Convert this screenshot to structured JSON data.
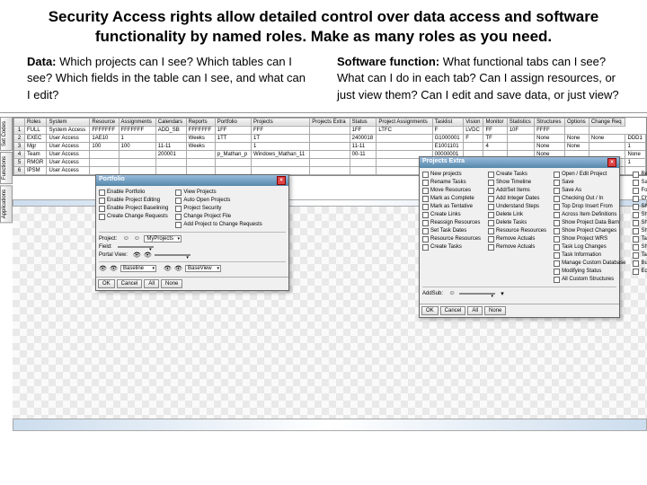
{
  "heading": "Security Access rights allow detailed control over data access and software functionality by named roles.  Make as many roles as you need.",
  "left_sub_label": "Data:",
  "left_sub_text": " Which projects can I see? Which tables can I see? Which fields in the table can I see, and what can I edit?",
  "right_sub_label": "Software function:",
  "right_sub_text": " What functional tabs can I see?  What can I do in each tab? Can I assign resources, or just view them? Can I edit and save data, or just view?",
  "vtabs": [
    "Set Codes",
    "Functions",
    "Applications"
  ],
  "columns": [
    "",
    "Roles",
    "System",
    "Resource",
    "Assignments",
    "Calendars",
    "Reports",
    "Portfolio",
    "Projects",
    "Projects Extra",
    "Status",
    "Project Assignments",
    "Tasklist",
    "Vision",
    "Monitor",
    "Statistics",
    "Structures",
    "Options",
    "Change Req"
  ],
  "rows": [
    [
      "1",
      "FULL",
      "System Access",
      "FFFFFFF",
      "FFFFFFF",
      "ADD_SB",
      "FFFFFFF",
      "1FF",
      "FFF",
      "",
      "1FF",
      "LTFC",
      "F",
      "LVDC",
      "FF",
      "10F",
      "FFFF",
      ""
    ],
    [
      "2",
      "EXEC",
      "User Access",
      "1AE10",
      "1",
      "",
      "Weeks",
      "1TT",
      "1T",
      "",
      "2400018",
      "",
      "G1000001",
      "F",
      "TF",
      "",
      "None",
      "None",
      "None",
      "DDD1"
    ],
    [
      "3",
      "Mgr",
      "User Access",
      "100",
      "100",
      "11-11",
      "Weeks",
      "",
      "1",
      "",
      "11-11",
      "",
      "E1001101",
      "",
      "4",
      "",
      "None",
      "None",
      "",
      "1"
    ],
    [
      "4",
      "Team",
      "User Access",
      "",
      "",
      "200001",
      "",
      "p_Mathan_p",
      "Windows_Mathan_11",
      "",
      "00-11",
      "",
      "00000001",
      "",
      "",
      "",
      "None",
      "",
      "",
      "None"
    ],
    [
      "5",
      "RMGR",
      "User Access",
      "",
      "",
      "",
      "",
      "",
      "",
      "",
      "",
      "",
      "",
      "",
      "",
      "",
      "",
      "",
      "",
      "1"
    ],
    [
      "6",
      "IPSM",
      "User Access",
      "",
      "",
      "",
      "",
      "",
      "",
      "",
      "",
      "",
      "",
      "",
      "",
      "",
      "",
      "",
      "",
      ""
    ]
  ],
  "popup1": {
    "title": "Portfolio",
    "colA": [
      "Enable Portfolio",
      "Enable Project Editing",
      "Enable Project Baselining",
      "Create Change Requests"
    ],
    "colB": [
      "View Projects",
      "Auto Open Projects",
      "Project Security",
      "Change Project File",
      "Add Project to Change Requests"
    ],
    "projectLabel": "Project:",
    "projectVal": "MyProjects",
    "fieldLabel": "Field:",
    "portalLabel": "Portal View:",
    "colC": [
      "",
      "",
      "",
      "Baseline",
      "BaseView"
    ]
  },
  "popup2": {
    "title": "Projects Extra",
    "colA": [
      "New projects",
      "Rename Tasks",
      "Move Resources",
      "Mark as Complete",
      "Mark as Tentative",
      "Create Links",
      "Reassign Resources",
      "Set Task Dates",
      "Resource Resources",
      "Create Tasks"
    ],
    "colB": [
      "Create Tasks",
      "Show Timeline",
      "Add/Set Items",
      "Add Integer Dates",
      "Understand Steps",
      "Delete Link",
      "Delete Tasks",
      "Resource Resources",
      "Remove Actuals",
      "Remove Actuals"
    ],
    "colC": [
      "Open / Edit Project",
      "Save",
      "Save As",
      "Checking Out / In",
      "Top Drop Insert From",
      "Across Item Definitions",
      "Show Project Data Barn",
      "Show Project Changes",
      "Show Project WRS",
      "Task Log Changes",
      "Task Information",
      "Manage Custom Database",
      "Modifying Status",
      "All Custom Structures"
    ],
    "colD": [
      "Rename Projects",
      "Save All",
      "Force Check In",
      "Check From Database",
      "Show Tabular",
      "Show Analytics",
      "Show More Fields",
      "Show Planner",
      "Task Outlines",
      "Show Enter Database",
      "Task Edit Database",
      "Bulk Task Operations",
      "Edit Resources"
    ]
  },
  "btns": {
    "ok": "OK",
    "cancel": "Cancel",
    "all": "All",
    "none": "None"
  },
  "row4_extra": [
    "Rename Projects",
    "None",
    "1"
  ]
}
